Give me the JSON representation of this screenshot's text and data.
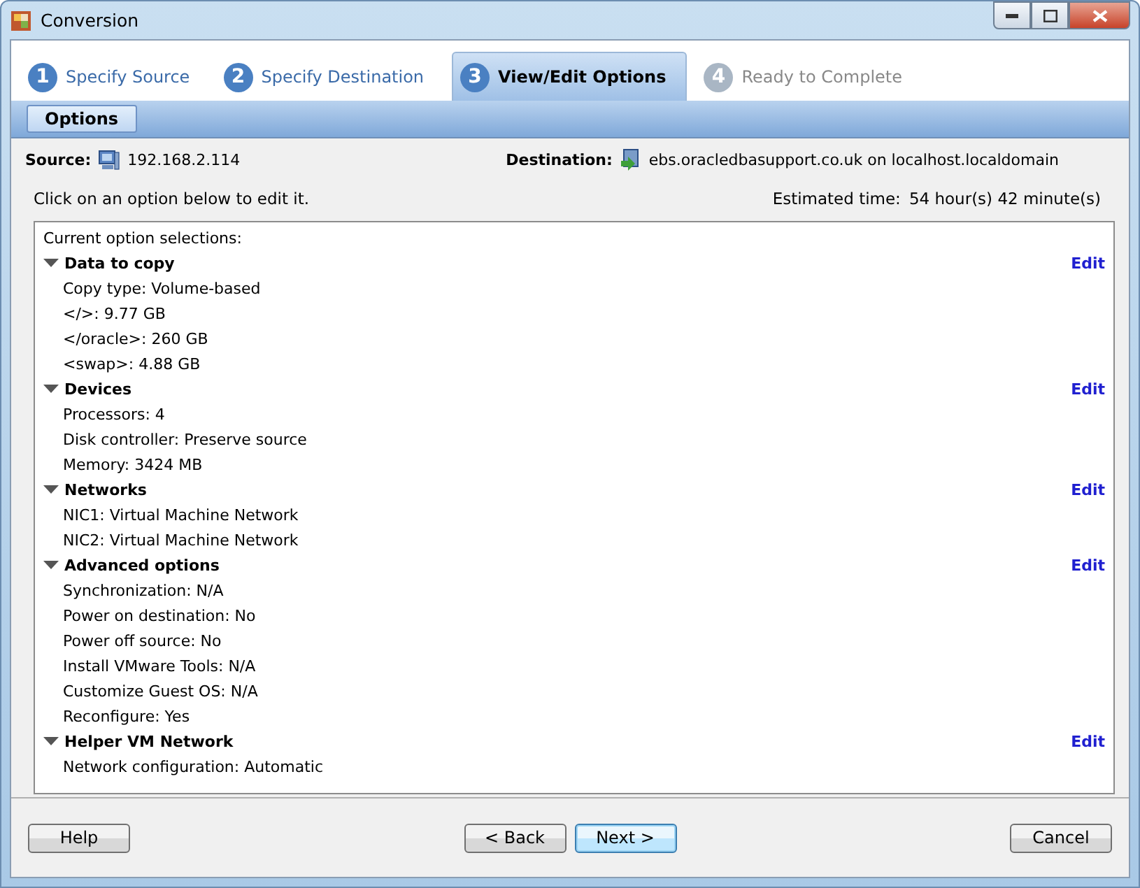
{
  "window": {
    "title": "Conversion"
  },
  "steps": [
    {
      "number": "1",
      "label": "Specify Source",
      "selected": false,
      "disabled": false
    },
    {
      "number": "2",
      "label": "Specify Destination",
      "selected": false,
      "disabled": false
    },
    {
      "number": "3",
      "label": "View/Edit Options",
      "selected": true,
      "disabled": false
    },
    {
      "number": "4",
      "label": "Ready to Complete",
      "selected": false,
      "disabled": true
    }
  ],
  "subtabs": [
    {
      "label": "Options",
      "selected": true
    }
  ],
  "source": {
    "label": "Source:",
    "value": "192.168.2.114"
  },
  "destination": {
    "label": "Destination:",
    "value": "ebs.oracledbasupport.co.uk on localhost.localdomain"
  },
  "hint": "Click on an option below to edit it.",
  "estimated_time": {
    "label": "Estimated time:",
    "value": "54 hour(s) 42 minute(s)"
  },
  "options": {
    "heading": "Current option selections:",
    "sections": [
      {
        "title": "Data to copy",
        "expanded": true,
        "action": "Edit",
        "items": [
          "Copy type: Volume-based",
          "</>: 9.77 GB",
          "</oracle>: 260 GB",
          "<swap>: 4.88 GB"
        ]
      },
      {
        "title": "Devices",
        "expanded": true,
        "action": "Edit",
        "items": [
          "Processors: 4",
          "Disk controller: Preserve source",
          "Memory: 3424 MB"
        ]
      },
      {
        "title": "Networks",
        "expanded": true,
        "action": "Edit",
        "items": [
          "NIC1: Virtual Machine Network",
          "NIC2: Virtual Machine Network"
        ]
      },
      {
        "title": "Advanced options",
        "expanded": true,
        "action": "Edit",
        "items": [
          "Synchronization: N/A",
          "Power on destination: No",
          "Power off source: No",
          "Install VMware Tools: N/A",
          "Customize Guest OS: N/A",
          "Reconfigure: Yes"
        ]
      },
      {
        "title": "Helper VM Network",
        "expanded": true,
        "action": "Edit",
        "items": [
          "Network configuration: Automatic"
        ]
      }
    ]
  },
  "buttons": [
    {
      "label": "Help",
      "kind": "help",
      "default": false
    },
    {
      "label": "< Back",
      "kind": "nav",
      "default": false
    },
    {
      "label": "Next >",
      "kind": "nav",
      "default": true
    },
    {
      "label": "Cancel",
      "kind": "cancel",
      "default": false
    }
  ]
}
